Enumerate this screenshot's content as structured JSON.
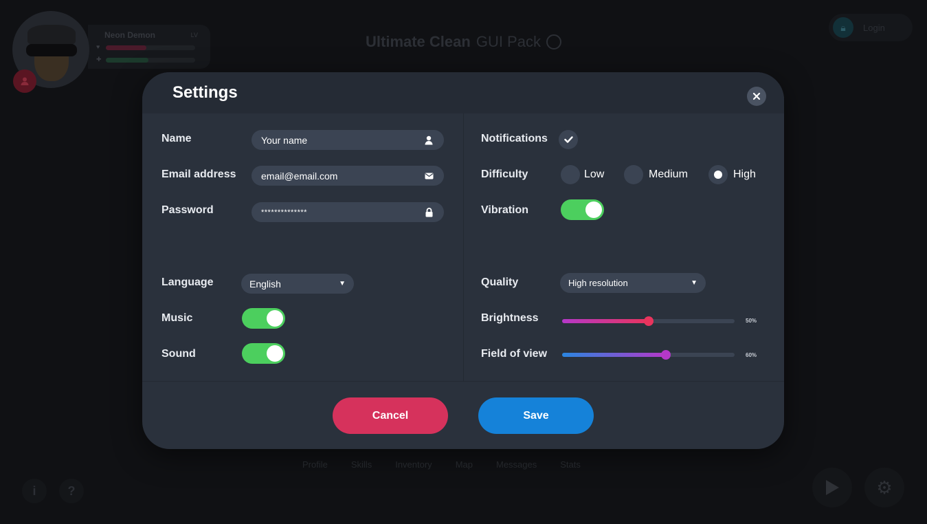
{
  "background": {
    "player": {
      "name": "Neon Demon",
      "level_label": "LV",
      "hp": 0.45,
      "energy": 0.48
    },
    "title_bold": "Ultimate Clean",
    "title_light": "GUI Pack",
    "login_label": "Login",
    "nav": [
      "Profile",
      "Skills",
      "Inventory",
      "Map",
      "Messages",
      "Stats"
    ],
    "info_label": "i",
    "help_label": "?"
  },
  "modal": {
    "title": "Settings",
    "close_icon": "close-icon",
    "left": {
      "name_label": "Name",
      "name_placeholder": "Your name",
      "email_label": "Email address",
      "email_value": "email@email.com",
      "password_label": "Password",
      "password_value": "**************",
      "language_label": "Language",
      "language_value": "English",
      "music_label": "Music",
      "music_on": true,
      "sound_label": "Sound",
      "sound_on": true
    },
    "right": {
      "notifications_label": "Notifications",
      "notifications_on": true,
      "difficulty_label": "Difficulty",
      "difficulty_options": [
        "Low",
        "Medium",
        "High"
      ],
      "difficulty_selected": "High",
      "vibration_label": "Vibration",
      "vibration_on": true,
      "quality_label": "Quality",
      "quality_value": "High resolution",
      "brightness_label": "Brightness",
      "brightness_value": 50,
      "brightness_text": "50%",
      "fov_label": "Field of view",
      "fov_value": 60,
      "fov_text": "60%"
    },
    "cancel_label": "Cancel",
    "save_label": "Save"
  },
  "colors": {
    "modal_bg": "#2a313c",
    "field_bg": "#3b4453",
    "toggle_on": "#4ccf5e",
    "cancel": "#d6325c",
    "save": "#1582d9",
    "brightness_start": "#b538c9",
    "brightness_end": "#e8345d",
    "fov_start": "#2a86e0",
    "fov_end": "#b538c9"
  }
}
